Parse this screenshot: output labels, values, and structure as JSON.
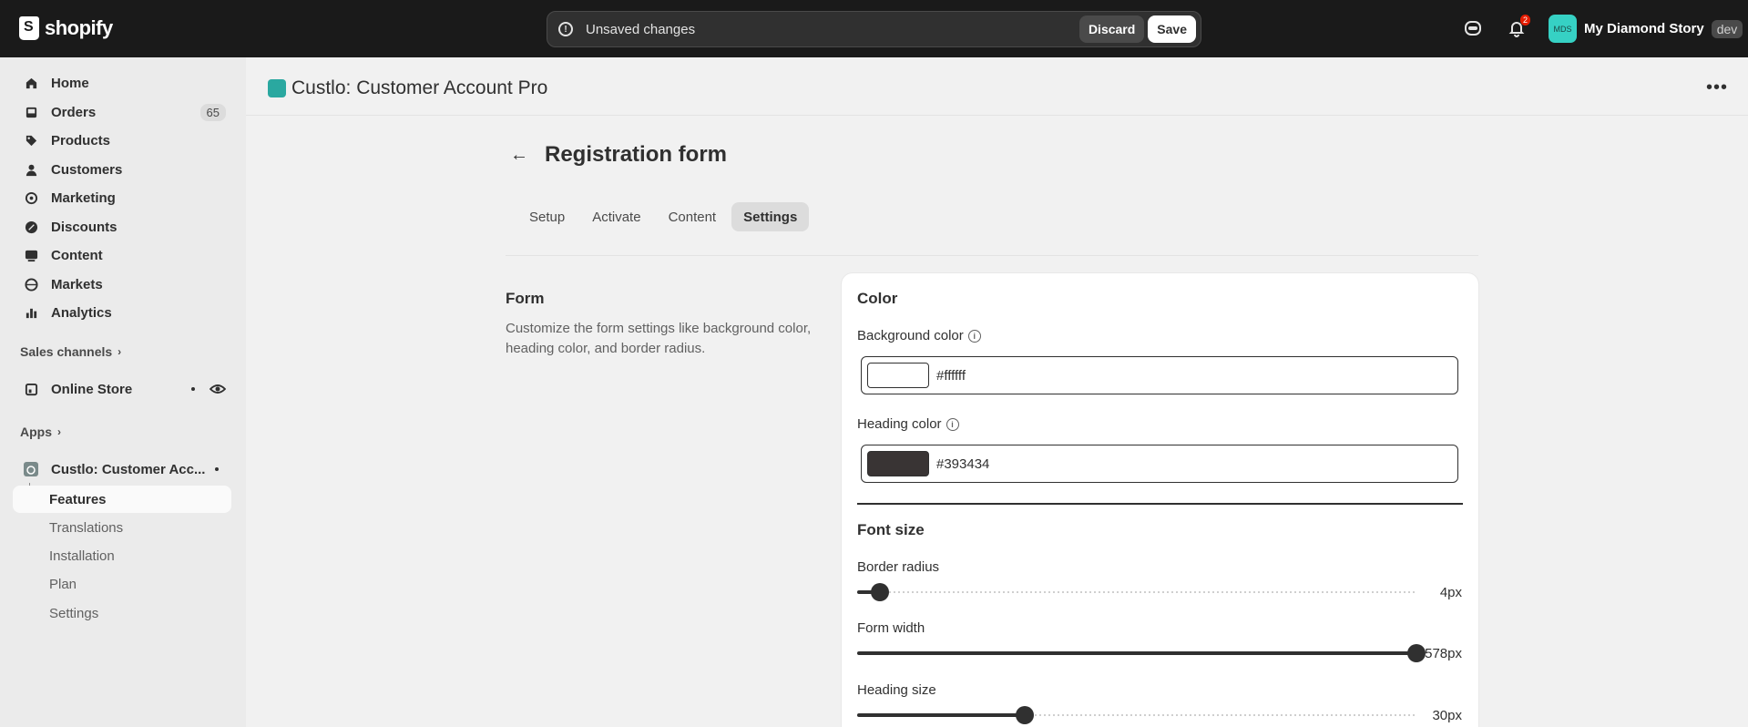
{
  "topbar": {
    "brand": "shopify",
    "unsaved_message": "Unsaved changes",
    "discard_label": "Discard",
    "save_label": "Save",
    "notifications_count": "2",
    "store_initials": "MDS",
    "store_name": "My Diamond Story",
    "store_tag": "dev"
  },
  "sidebar": {
    "items": [
      {
        "label": "Home",
        "icon": "home-icon"
      },
      {
        "label": "Orders",
        "icon": "inbox-icon",
        "count": "65"
      },
      {
        "label": "Products",
        "icon": "tag-icon"
      },
      {
        "label": "Customers",
        "icon": "person-icon"
      },
      {
        "label": "Marketing",
        "icon": "target-icon"
      },
      {
        "label": "Discounts",
        "icon": "discount-icon"
      },
      {
        "label": "Content",
        "icon": "image-icon"
      },
      {
        "label": "Markets",
        "icon": "globe-icon"
      },
      {
        "label": "Analytics",
        "icon": "bar-chart-icon"
      }
    ],
    "sales_channels_label": "Sales channels",
    "online_store_label": "Online Store",
    "apps_label": "Apps",
    "app_label": "Custlo: Customer Acc...",
    "app_subitems": [
      "Features",
      "Translations",
      "Installation",
      "Plan",
      "Settings"
    ]
  },
  "app_header": {
    "title": "Custlo: Customer Account Pro"
  },
  "page": {
    "title": "Registration form",
    "tabs": [
      "Setup",
      "Activate",
      "Content",
      "Settings"
    ],
    "active_tab": "Settings",
    "section_title": "Form",
    "section_description": "Customize the form settings like background color, heading color, and border radius."
  },
  "card": {
    "color_heading": "Color",
    "background_color_label": "Background color",
    "background_color_value": "#ffffff",
    "heading_color_label": "Heading color",
    "heading_color_value": "#393434",
    "font_size_heading": "Font size",
    "sliders": [
      {
        "label": "Border radius",
        "value_text": "4px",
        "fraction": 0.04
      },
      {
        "label": "Form width",
        "value_text": "578px",
        "fraction": 1.0
      },
      {
        "label": "Heading size",
        "value_text": "30px",
        "fraction": 0.3
      }
    ]
  },
  "colors": {
    "topbar_bg": "#1a1a1a",
    "page_bg": "#f1f1f1",
    "app_accent": "#2aa8a0",
    "store_avatar": "#36d1c4",
    "badge_red": "#e51c00"
  }
}
